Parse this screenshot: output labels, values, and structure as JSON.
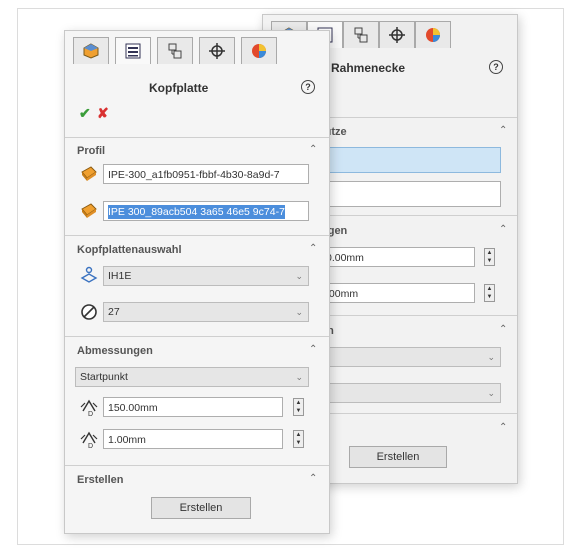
{
  "back_panel": {
    "title": "Rahmenecke",
    "help_symbol": "?",
    "sections": [
      {
        "label": "tütze"
      },
      {
        "label": "ngen"
      },
      {
        "label": "en"
      },
      {
        "label": ""
      }
    ],
    "dim1": "0.00mm",
    "dim2": ".00mm",
    "create_label": "Erstellen"
  },
  "front_panel": {
    "title": "Kopfplatte",
    "help_symbol": "?",
    "ok_symbol": "✔",
    "cancel_symbol": "✘",
    "profile": {
      "label": "Profil",
      "field1": "IPE-300_a1fb0951-fbbf-4b30-8a9d-7",
      "field2": "IPE 300_89acb504 3a65 46e5 9c74-7"
    },
    "selection": {
      "label": "Kopfplattenauswahl",
      "type_value": "IH1E",
      "number_value": "27"
    },
    "dimensions": {
      "label": "Abmessungen",
      "startpoint": "Startpunkt",
      "value1": "150.00mm",
      "value2": "1.00mm"
    },
    "create": {
      "label": "Erstellen",
      "button": "Erstellen"
    }
  },
  "tab_icons": [
    "feature-manager-icon",
    "property-manager-icon",
    "configuration-manager-icon",
    "dimxpert-icon",
    "display-manager-icon"
  ],
  "colors": {
    "ok": "#3a9d3a",
    "cancel": "#d93030",
    "selection": "#4c8edc",
    "orange": "#f0a030"
  }
}
